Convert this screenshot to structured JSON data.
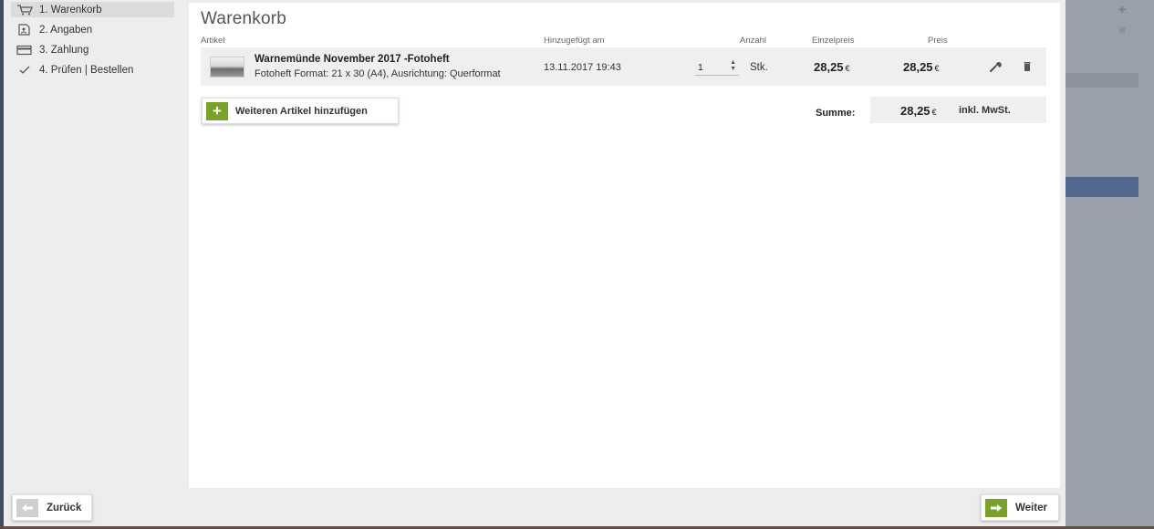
{
  "steps": [
    {
      "label": "1. Warenkorb",
      "icon": "cart-icon",
      "active": true
    },
    {
      "label": "2. Angaben",
      "icon": "address-card-icon"
    },
    {
      "label": "3. Zahlung",
      "icon": "credit-card-icon"
    },
    {
      "label": "4. Prüfen | Bestellen",
      "icon": "check-icon"
    }
  ],
  "cart": {
    "title": "Warenkorb",
    "columns": {
      "article": "Artikel",
      "added": "Hinzugefügt am",
      "quantity": "Anzahl",
      "unit_price": "Einzelpreis",
      "price": "Preis"
    },
    "items": [
      {
        "name": "Warnemünde November 2017 -Fotoheft",
        "description": "Fotoheft Format: 21 x 30 (A4), Ausrichtung: Querformat",
        "added": "13.11.2017 19:43",
        "quantity": "1",
        "unit": "Stk.",
        "unit_price": "28,25",
        "price": "28,25",
        "currency": "€"
      }
    ],
    "add_button": "Weiteren Artikel hinzufügen",
    "sum_label": "Summe:",
    "sum_value": "28,25",
    "sum_currency": "€",
    "tax_note": "inkl. MwSt."
  },
  "footer": {
    "back": "Zurück",
    "next": "Weiter"
  },
  "colors": {
    "accent": "#7aa22a",
    "panel": "#ededed",
    "row": "#efefef"
  }
}
